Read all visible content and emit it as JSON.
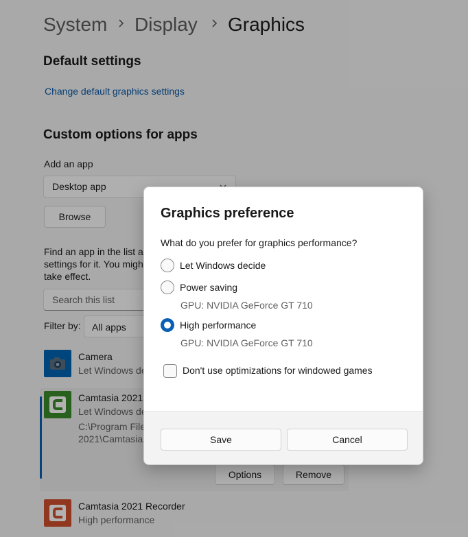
{
  "breadcrumb": [
    "System",
    "Display",
    "Graphics"
  ],
  "default_settings": {
    "heading": "Default settings",
    "link": "Change default graphics settings"
  },
  "custom_options": {
    "heading": "Custom options for apps",
    "add_app_label": "Add an app",
    "app_type": "Desktop app",
    "browse_label": "Browse",
    "description_lines": [
      "Find an app in the list a",
      "settings for it. You migh",
      "take effect."
    ],
    "search_placeholder": "Search this list",
    "filter_label": "Filter by:",
    "filter_value": "All apps"
  },
  "apps": [
    {
      "name": "Camera",
      "status": "Let Windows de"
    },
    {
      "name": "Camtasia 2021",
      "status": "Let Windows de",
      "path_lines": [
        "C:\\Program File",
        "2021\\Camtasias"
      ],
      "options_label": "Options",
      "remove_label": "Remove"
    },
    {
      "name": "Camtasia 2021 Recorder",
      "status": "High performance"
    }
  ],
  "dialog": {
    "title": "Graphics preference",
    "question": "What do you prefer for graphics performance?",
    "options": [
      {
        "label": "Let Windows decide",
        "gpu": "",
        "selected": false
      },
      {
        "label": "Power saving",
        "gpu": "GPU: NVIDIA GeForce GT 710",
        "selected": false
      },
      {
        "label": "High performance",
        "gpu": "GPU: NVIDIA GeForce GT 710",
        "selected": true
      }
    ],
    "checkbox_label": "Don't use optimizations for windowed games",
    "checkbox_checked": false,
    "save_label": "Save",
    "cancel_label": "Cancel"
  },
  "colors": {
    "accent": "#0a5fb4",
    "link": "#0a59a8",
    "camera_icon": "#0063b1",
    "camtasia_icon": "#3a8a2a",
    "recorder_icon": "#d0502e"
  }
}
